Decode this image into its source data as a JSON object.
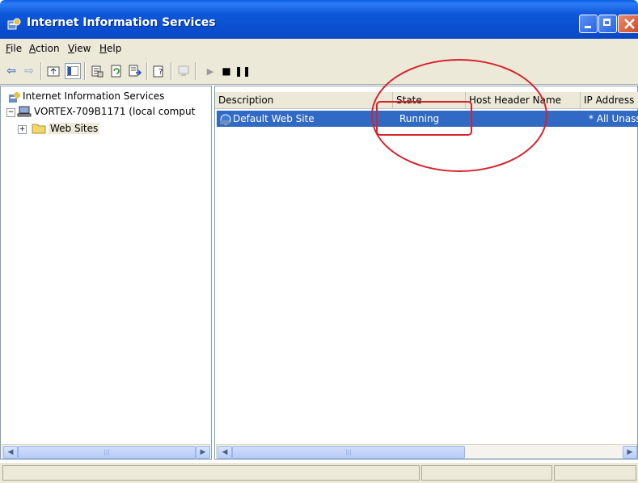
{
  "window": {
    "title": "Internet Information Services"
  },
  "menu": [
    {
      "key": "F",
      "rest": "ile"
    },
    {
      "key": "A",
      "rest": "ction"
    },
    {
      "key": "V",
      "rest": "iew"
    },
    {
      "key": "H",
      "rest": "elp"
    }
  ],
  "tree": {
    "root": "Internet Information Services",
    "computer": "VORTEX-709B1171 (local comput",
    "web_sites": "Web Sites"
  },
  "list": {
    "columns": [
      "Description",
      "State",
      "Host Header Name",
      "IP Address"
    ],
    "rows": [
      {
        "description": "Default Web Site",
        "state": "Running",
        "host_header": "",
        "ip": "* All Unassigned"
      }
    ]
  },
  "colors": {
    "selection": "#316ac5",
    "annotation": "#d8212a",
    "titlebar": "#0a58dd"
  }
}
